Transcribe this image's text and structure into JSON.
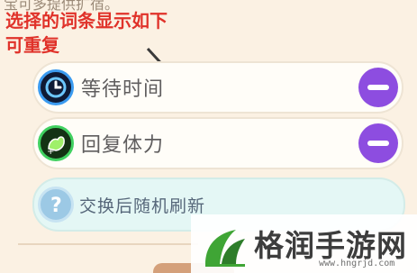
{
  "header": {
    "cut_text": "宝可多提供扩宿。",
    "annotation_line1": "选择的词条显示如下",
    "annotation_line2": "可重复"
  },
  "entries": [
    {
      "label": "等待时间",
      "icon": "clock-icon",
      "action": "remove"
    },
    {
      "label": "回复体力",
      "icon": "muscle-icon",
      "action": "remove"
    },
    {
      "label": "交换后随机刷新",
      "icon": "question-icon"
    }
  ],
  "watermark": {
    "title": "格润手游网",
    "url": "www.hngrjd.com"
  },
  "colors": {
    "background": "#fbf1e3",
    "annotation": "#e0322a",
    "remove_button": "#8d4de0",
    "refresh_row": "#e4f7f5"
  }
}
